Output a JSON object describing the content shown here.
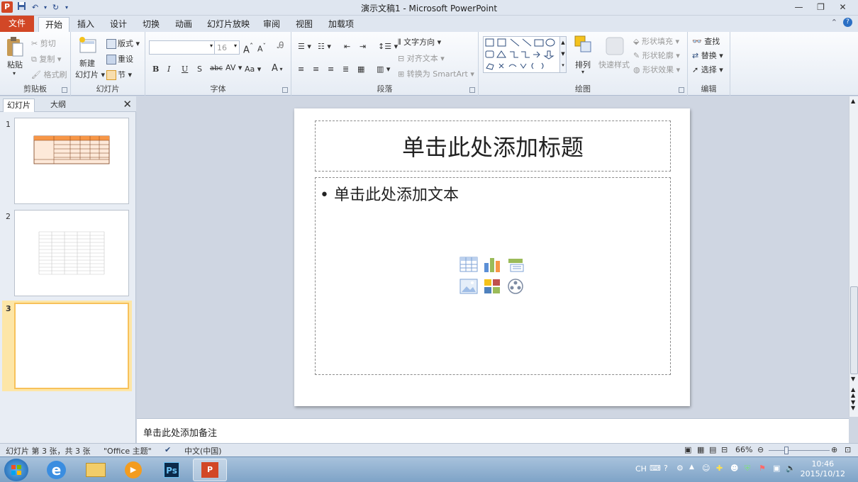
{
  "app": {
    "title": "演示文稿1 - Microsoft PowerPoint",
    "logo": "P"
  },
  "qat": [
    "save-icon",
    "undo-icon",
    "redo-icon",
    "customize-icon"
  ],
  "tabs": {
    "file": "文件",
    "items": [
      "开始",
      "插入",
      "设计",
      "切换",
      "动画",
      "幻灯片放映",
      "审阅",
      "视图",
      "加载项"
    ]
  },
  "ribbon": {
    "clipboard": {
      "label": "剪贴板",
      "paste": "粘贴",
      "cut": "剪切",
      "copy": "复制",
      "format_painter": "格式刷"
    },
    "slides": {
      "label": "幻灯片",
      "new_slide_top": "新建",
      "new_slide_bottom": "幻灯片",
      "layout": "版式",
      "reset": "重设",
      "section": "节"
    },
    "font": {
      "label": "字体",
      "size": "16"
    },
    "paragraph": {
      "label": "段落",
      "text_direction": "文字方向",
      "align_text": "对齐文本",
      "smartart": "转换为 SmartArt"
    },
    "drawing": {
      "label": "绘图",
      "arrange": "排列",
      "quick_styles": "快速样式",
      "shape_fill": "形状填充",
      "shape_outline": "形状轮廓",
      "shape_effects": "形状效果"
    },
    "editing": {
      "label": "编辑",
      "find": "查找",
      "replace": "替换",
      "select": "选择"
    }
  },
  "pane": {
    "tab_slides": "幻灯片",
    "tab_outline": "大纲",
    "thumbs": [
      {
        "num": "1"
      },
      {
        "num": "2"
      },
      {
        "num": "3"
      }
    ]
  },
  "slide": {
    "title_placeholder": "单击此处添加标题",
    "body_placeholder": "单击此处添加文本",
    "bullet": "•"
  },
  "notes": {
    "placeholder": "单击此处添加备注"
  },
  "status": {
    "slide_info": "幻灯片 第 3 张，共 3 张",
    "theme": "\"Office 主题\"",
    "language": "中文(中国)",
    "zoom": "66%"
  },
  "taskbar": {
    "lang": "CH",
    "time": "10:46",
    "date": "2015/10/12"
  },
  "colors": {
    "file_tab": "#d24726",
    "selection": "#f7c15a",
    "ribbon_bg": "#fbfcfe"
  }
}
